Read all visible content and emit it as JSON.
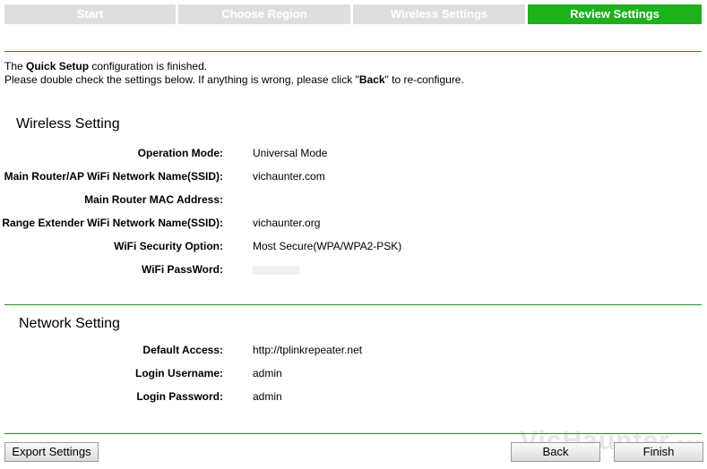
{
  "steps": [
    {
      "label": "Start",
      "active": false
    },
    {
      "label": "Choose Region",
      "active": false
    },
    {
      "label": "Wireless Settings",
      "active": false
    },
    {
      "label": "Review Settings",
      "active": true
    }
  ],
  "intro": {
    "line1_pre": "The ",
    "line1_bold": "Quick Setup",
    "line1_post": " configuration is finished.",
    "line2_pre": "Please double check the settings below. If anything is wrong, please click \"",
    "line2_bold": "Back",
    "line2_post": "\" to re-configure."
  },
  "wireless": {
    "title": "Wireless Setting",
    "rows": [
      {
        "label": "Operation Mode:",
        "value": "Universal Mode"
      },
      {
        "label": "Main Router/AP WiFi Network Name(SSID):",
        "value": "vichaunter.com"
      },
      {
        "label": "Main Router MAC Address:",
        "value": ""
      },
      {
        "label": "Range Extender WiFi Network Name(SSID):",
        "value": "vichaunter.org"
      },
      {
        "label": "WiFi Security Option:",
        "value": "Most Secure(WPA/WPA2-PSK)"
      },
      {
        "label": "WiFi PassWord:",
        "value": ""
      }
    ]
  },
  "network": {
    "title": "Network Setting",
    "rows": [
      {
        "label": "Default Access:",
        "value": "http://tplinkrepeater.net"
      },
      {
        "label": "Login Username:",
        "value": "admin"
      },
      {
        "label": "Login Password:",
        "value": "admin"
      }
    ]
  },
  "buttons": {
    "export": "Export Settings",
    "back": "Back",
    "finish": "Finish"
  },
  "watermark": {
    "main": "VicHaunter",
    "suffix": ".org"
  },
  "colors": {
    "accent": "#1db11d",
    "inactive_step": "#dedede",
    "divider": "#2a8a2a"
  }
}
